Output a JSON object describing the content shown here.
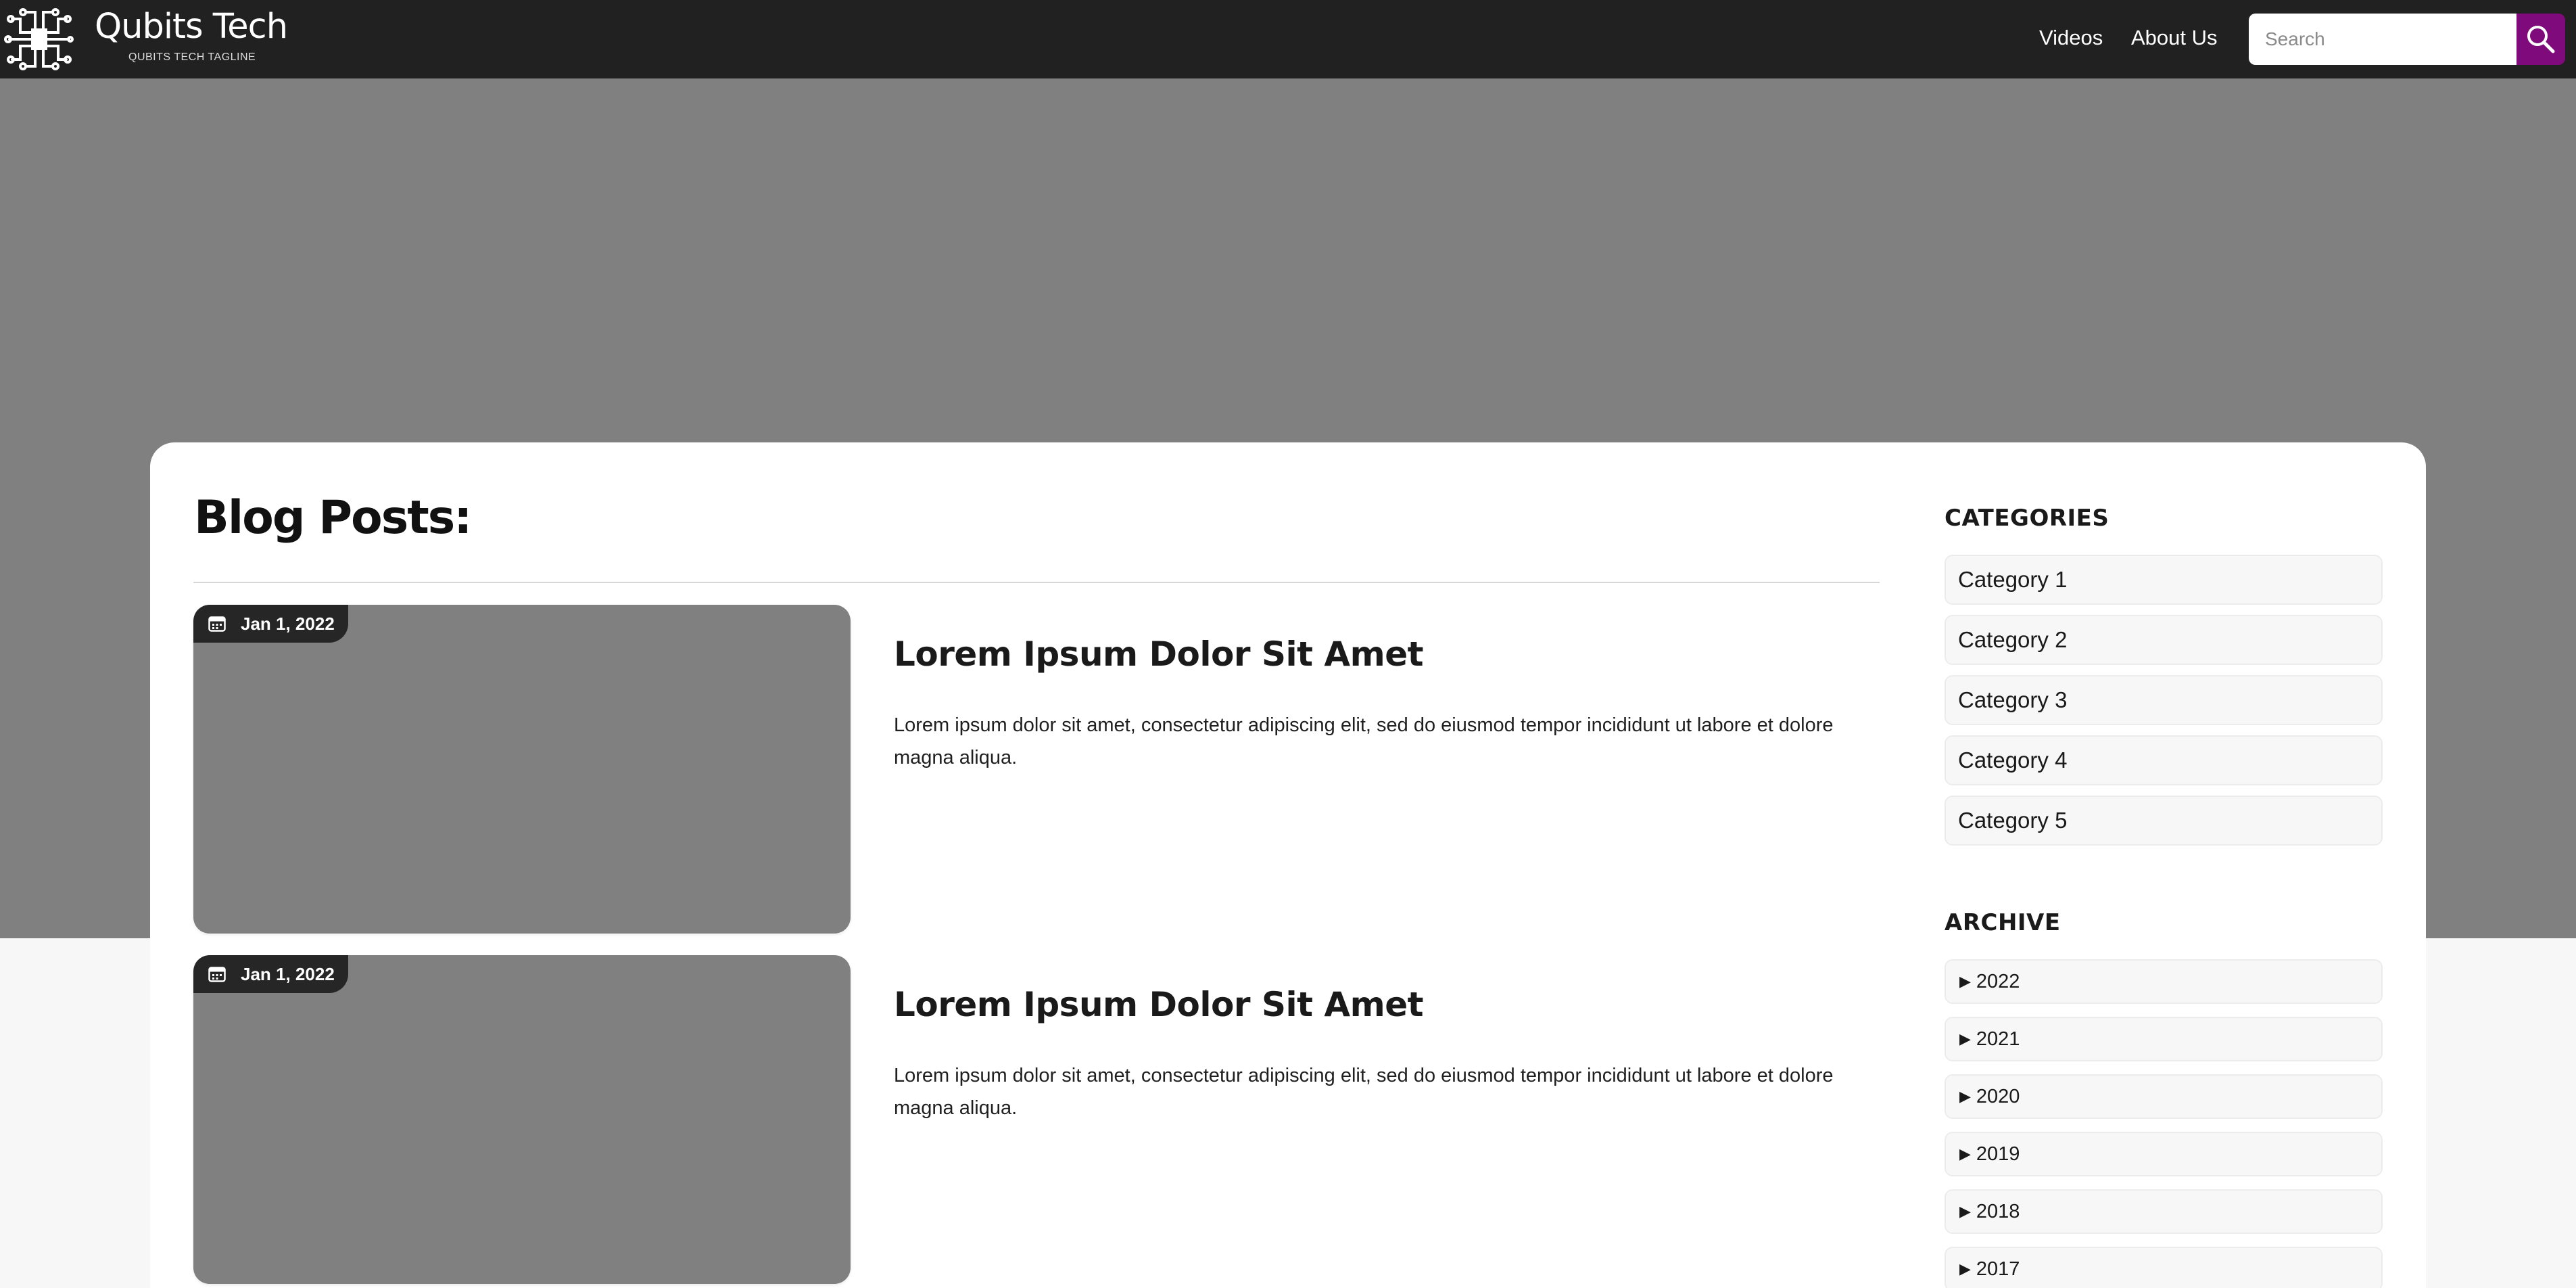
{
  "header": {
    "brand_name": "Qubits Tech",
    "tagline": "QUBITS TECH TAGLINE",
    "nav": [
      {
        "label": "Videos"
      },
      {
        "label": "About Us"
      }
    ],
    "search": {
      "placeholder": "Search",
      "value": ""
    }
  },
  "colors": {
    "header_bg": "#212121",
    "accent": "#7f0a7b",
    "hero_bg": "#808080",
    "card_bg": "#ffffff"
  },
  "icons": {
    "logo": "circuit-chip-icon",
    "search": "magnifier-icon",
    "date": "calendar-icon",
    "archive_toggle": "triangle-right-icon"
  },
  "main": {
    "title": "Blog Posts:",
    "posts": [
      {
        "date": "Jan 1, 2022",
        "title": "Lorem Ipsum Dolor Sit Amet",
        "excerpt": "Lorem ipsum dolor sit amet, consectetur adipiscing elit, sed do eiusmod tempor incididunt ut labore et dolore magna aliqua."
      },
      {
        "date": "Jan 1, 2022",
        "title": "Lorem Ipsum Dolor Sit Amet",
        "excerpt": "Lorem ipsum dolor sit amet, consectetur adipiscing elit, sed do eiusmod tempor incididunt ut labore et dolore magna aliqua."
      }
    ]
  },
  "sidebar": {
    "categories_heading": "CATEGORIES",
    "categories": [
      "Category 1",
      "Category 2",
      "Category 3",
      "Category 4",
      "Category 5"
    ],
    "archive_heading": "ARCHIVE",
    "archive": [
      "2022",
      "2021",
      "2020",
      "2019",
      "2018",
      "2017"
    ]
  }
}
